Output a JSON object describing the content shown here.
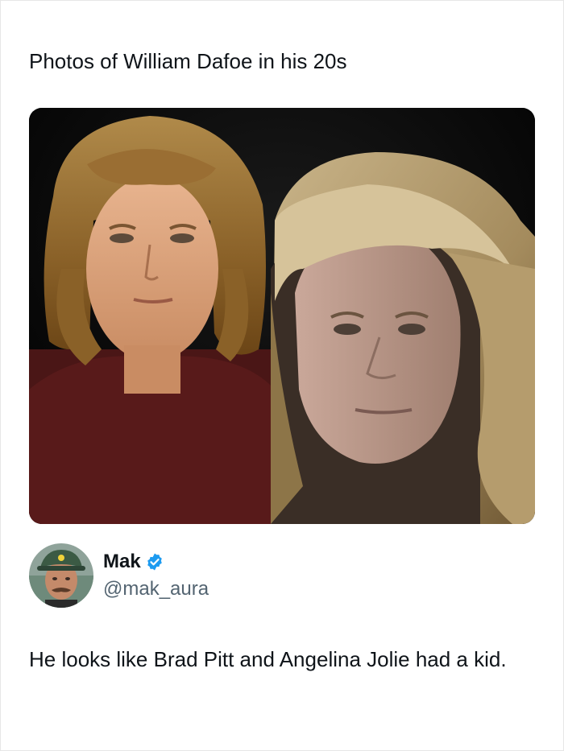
{
  "post": {
    "text": "Photos of William Dafoe in his 20s",
    "media": {
      "description_icon": "photo-collage",
      "background": "#050505"
    }
  },
  "reply": {
    "author": {
      "display_name": "Mak",
      "handle": "@mak_aura",
      "verified": true,
      "verified_color": "#1d9bf0",
      "avatar_icon": "profile-avatar"
    },
    "text": "He looks like Brad Pitt and Angelina Jolie had a kid."
  },
  "colors": {
    "text_primary": "#0f1419",
    "text_secondary": "#536471",
    "accent": "#1d9bf0"
  }
}
